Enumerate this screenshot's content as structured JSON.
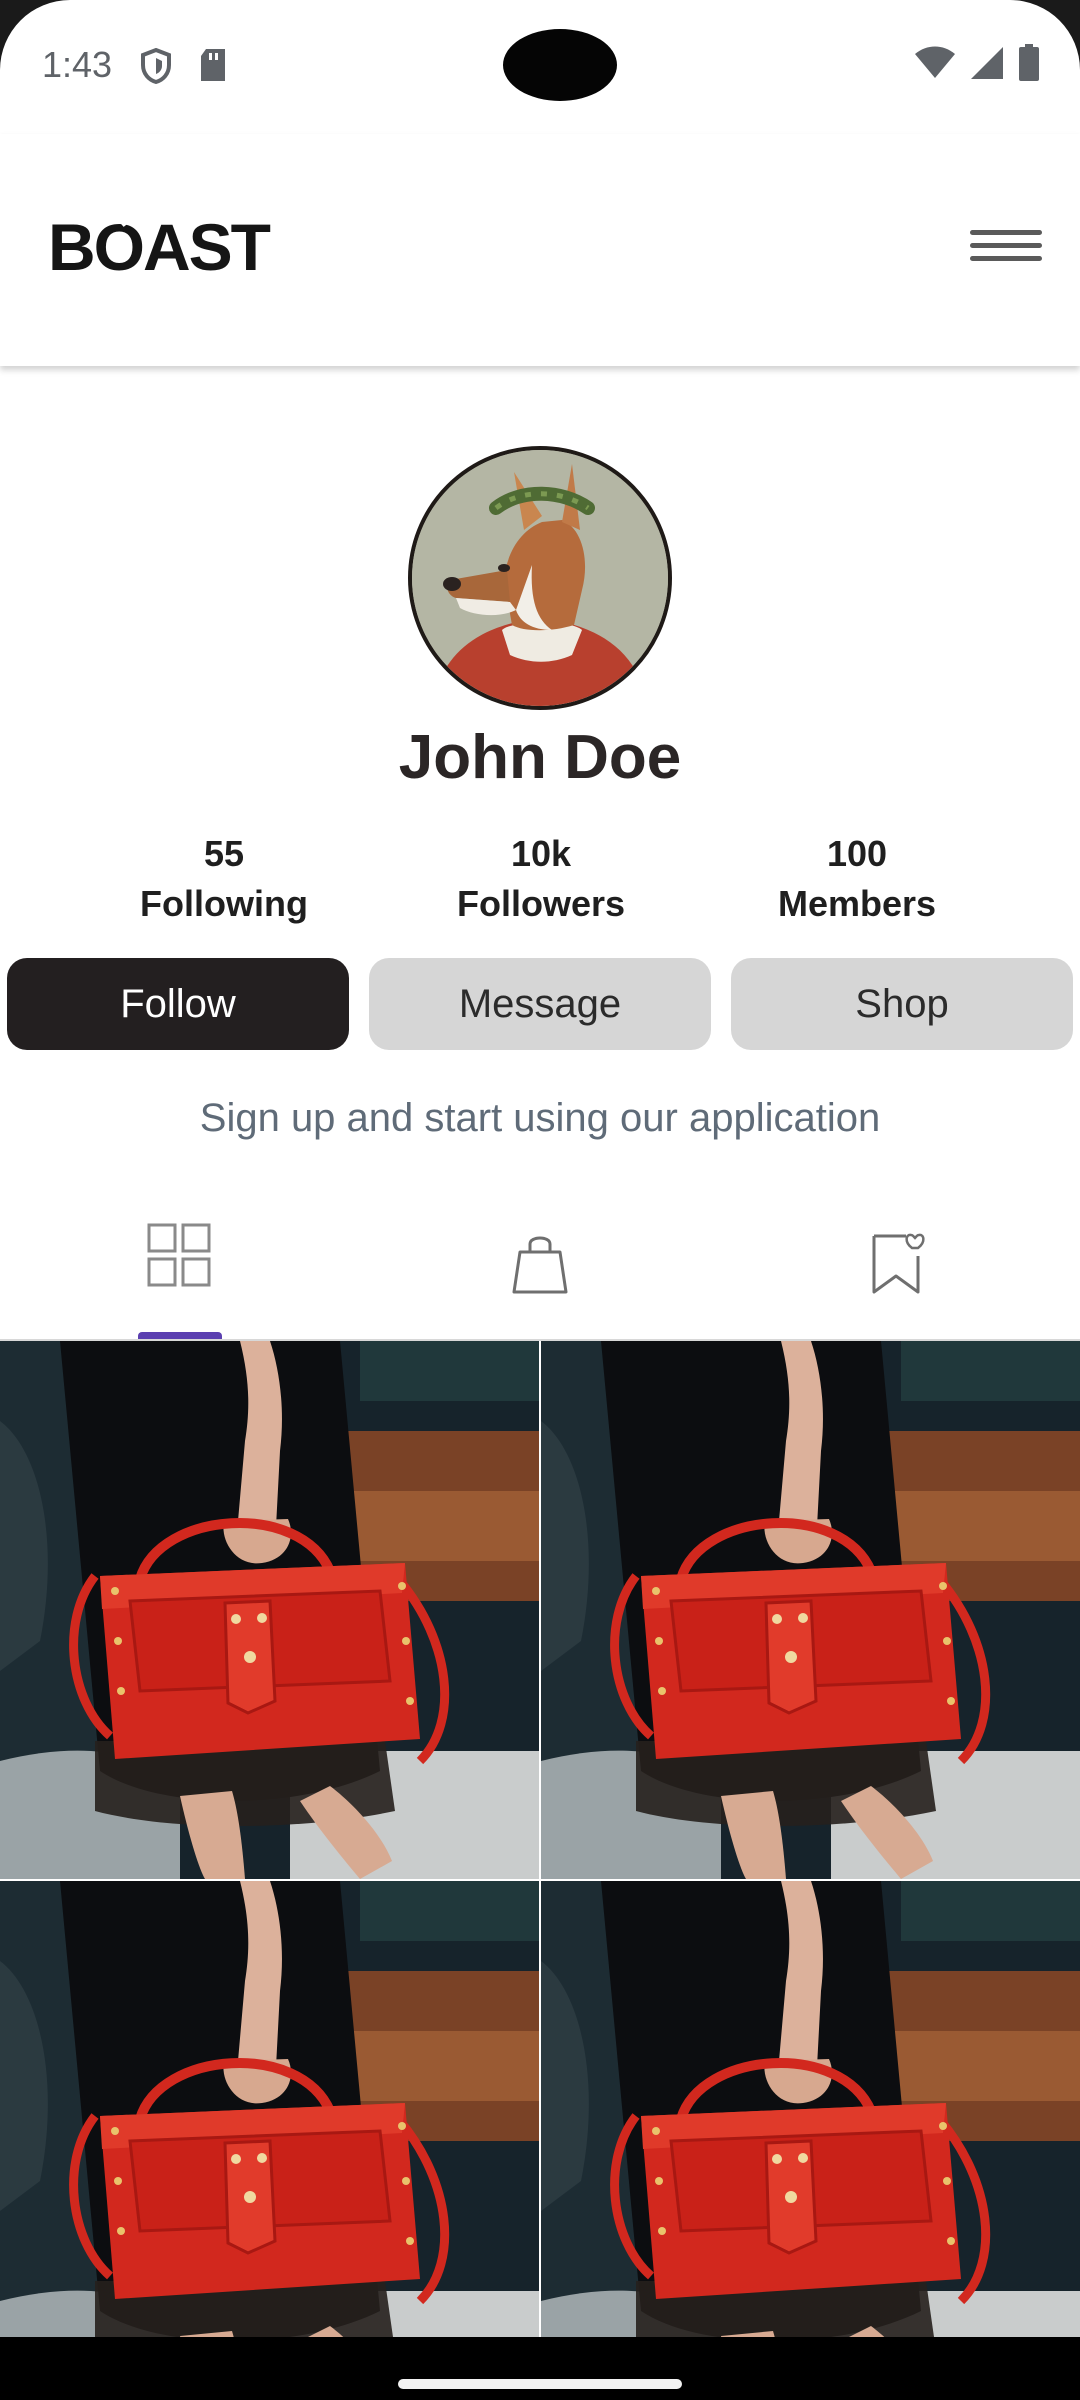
{
  "status_bar": {
    "time": "1:43",
    "icons": [
      "shield-icon",
      "sd-card-icon",
      "wifi-icon",
      "signal-icon",
      "battery-icon"
    ]
  },
  "header": {
    "logo_text": "BOAST",
    "menu_icon": "hamburger-menu-icon"
  },
  "profile": {
    "name": "John Doe",
    "stats": [
      {
        "value": "55",
        "label": "Following"
      },
      {
        "value": "10k",
        "label": "Followers"
      },
      {
        "value": "100",
        "label": "Members"
      }
    ],
    "buttons": {
      "follow": "Follow",
      "message": "Message",
      "shop": "Shop"
    },
    "tagline": "Sign up and  start using our application"
  },
  "tabs": [
    {
      "icon": "grid-icon",
      "active": true
    },
    {
      "icon": "shopping-bag-icon",
      "active": false
    },
    {
      "icon": "bookmark-heart-icon",
      "active": false
    }
  ],
  "colors": {
    "accent": "#5b3fb0",
    "primary_button": "#231f20",
    "secondary_button": "#d6d6d6",
    "bag_red": "#d2281e"
  },
  "posts": [
    {
      "image": "red-handbag-photo"
    },
    {
      "image": "red-handbag-photo"
    },
    {
      "image": "red-handbag-photo"
    },
    {
      "image": "red-handbag-photo"
    }
  ]
}
